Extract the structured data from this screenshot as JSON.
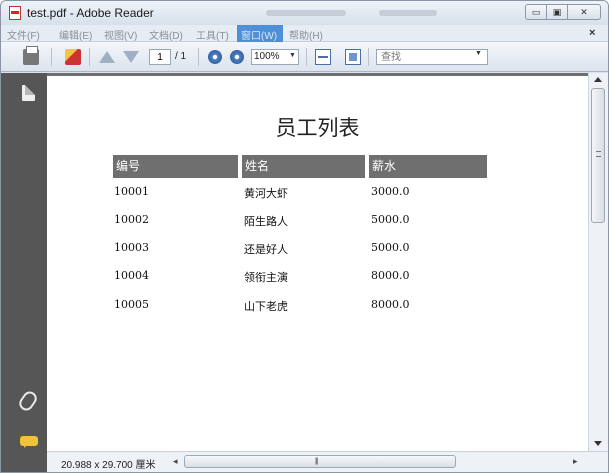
{
  "window": {
    "title": "test.pdf - Adobe Reader",
    "minimize_glyph": "▭",
    "maximize_glyph": "▣",
    "close_glyph": "✕"
  },
  "menu": {
    "items": [
      "文件(F)",
      "编辑(E)",
      "视图(V)",
      "文档(D)",
      "工具(T)",
      "窗口(W)",
      "帮助(H)"
    ],
    "close_glyph": "×"
  },
  "toolbar": {
    "current_page": "1",
    "total_pages": "/ 1",
    "zoom": "100%",
    "find_placeholder": "查找",
    "dropdown_glyph": "▼"
  },
  "document": {
    "title": "员工列表",
    "headers": [
      "编号",
      "姓名",
      "薪水"
    ],
    "rows": [
      [
        "10001",
        "黄河大虾",
        "3000.0"
      ],
      [
        "10002",
        "陌生路人",
        "5000.0"
      ],
      [
        "10003",
        "还是好人",
        "5000.0"
      ],
      [
        "10004",
        "领衔主演",
        "8000.0"
      ],
      [
        "10005",
        "山下老虎",
        "8000.0"
      ]
    ]
  },
  "status": {
    "page_size": "20.988 x 29.700 厘米",
    "left_arrow": "◂",
    "right_arrow": "▸",
    "grip": "|||"
  },
  "colors": {
    "nav_panel": "#565656",
    "table_header": "#6f6f6f",
    "window_menu_highlight": "#4f8fd6"
  }
}
